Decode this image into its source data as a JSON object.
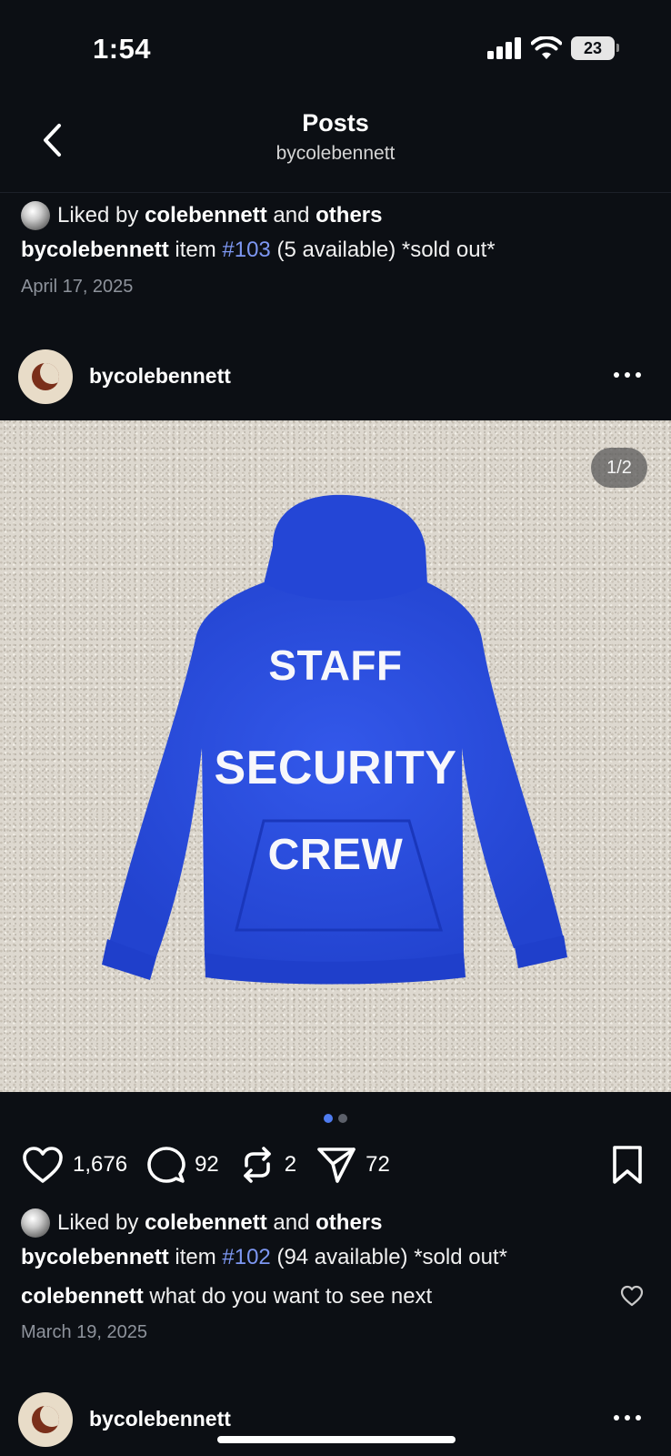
{
  "status_bar": {
    "time": "1:54",
    "battery": "23"
  },
  "header": {
    "title": "Posts",
    "subtitle": "bycolebennett"
  },
  "previous_post": {
    "liked_by_prefix": "Liked by",
    "liked_by_user": "colebennett",
    "liked_by_and": "and",
    "liked_by_others": "others",
    "caption_user": "bycolebennett",
    "caption_pre": "item",
    "caption_tag": "#103",
    "caption_post": "(5 available) *sold out*",
    "date": "April 17, 2025"
  },
  "post": {
    "username": "bycolebennett",
    "image_counter": "1/2",
    "hoodie_color": "#2b4fe0",
    "hoodie_lines": [
      "STAFF",
      "SECURITY",
      "CREW"
    ],
    "likes": "1,676",
    "comments": "92",
    "reposts": "2",
    "shares": "72",
    "liked_by_prefix": "Liked by",
    "liked_by_user": "colebennett",
    "liked_by_and": "and",
    "liked_by_others": "others",
    "caption_user": "bycolebennett",
    "caption_pre": "item",
    "caption_tag": "#102",
    "caption_post": "(94 available) *sold out*",
    "comment_user": "colebennett",
    "comment_text": "what do you want to see next",
    "date": "March 19, 2025"
  },
  "next_post": {
    "username": "bycolebennett"
  },
  "icons": {
    "back": "chevron-left-icon",
    "like": "heart-icon",
    "comment": "comment-bubble-icon",
    "repost": "repost-icon",
    "share": "paper-plane-icon",
    "save": "bookmark-icon",
    "more": "more-dots-icon"
  }
}
